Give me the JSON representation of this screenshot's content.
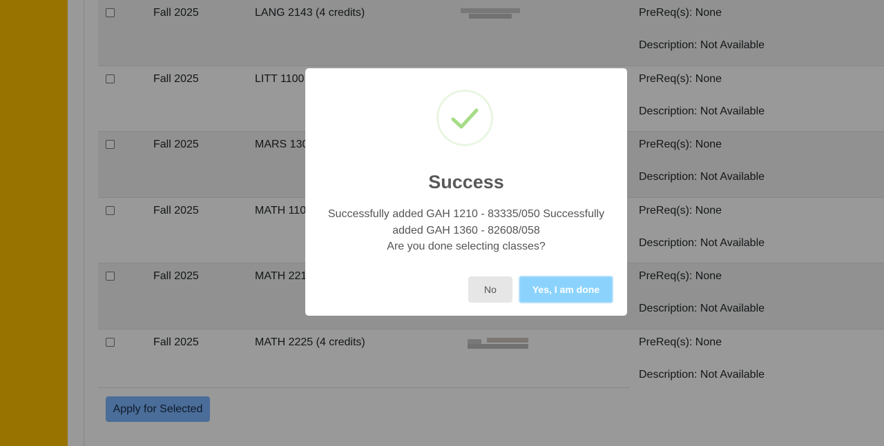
{
  "rows": [
    {
      "term": "Fall 2025",
      "course": "LANG 2143 (4 credits)",
      "prereq": "PreReq(s): None",
      "description": "Description: Not Available"
    },
    {
      "term": "Fall 2025",
      "course": "LITT 1100",
      "prereq": "PreReq(s): None",
      "description": "Description: Not Available"
    },
    {
      "term": "Fall 2025",
      "course": "MARS 130",
      "prereq": "PreReq(s): None",
      "description": "Description: Not Available"
    },
    {
      "term": "Fall 2025",
      "course": "MATH 110",
      "prereq": "PreReq(s): None",
      "description": "Description: Not Available"
    },
    {
      "term": "Fall 2025",
      "course": "MATH 221",
      "prereq": "PreReq(s): None",
      "description": "Description: Not Available"
    },
    {
      "term": "Fall 2025",
      "course": "MATH 2225 (4 credits)",
      "prereq": "PreReq(s): None",
      "description": "Description: Not Available"
    }
  ],
  "apply_button": "Apply for Selected",
  "modal": {
    "icon": "checkmark-success-icon",
    "title": "Success",
    "message_line1": "Successfully added GAH 1210 - 83335/050 Successfully added GAH 1360 - 82608/058",
    "message_line2": "Are you done selecting classes?",
    "no_label": "No",
    "yes_label": "Yes, I am done"
  },
  "colors": {
    "sidebar": "#ffc000",
    "success_green": "#a5dc86",
    "confirm_button": "#8bd3fd",
    "apply_button": "#7cb6ff"
  }
}
